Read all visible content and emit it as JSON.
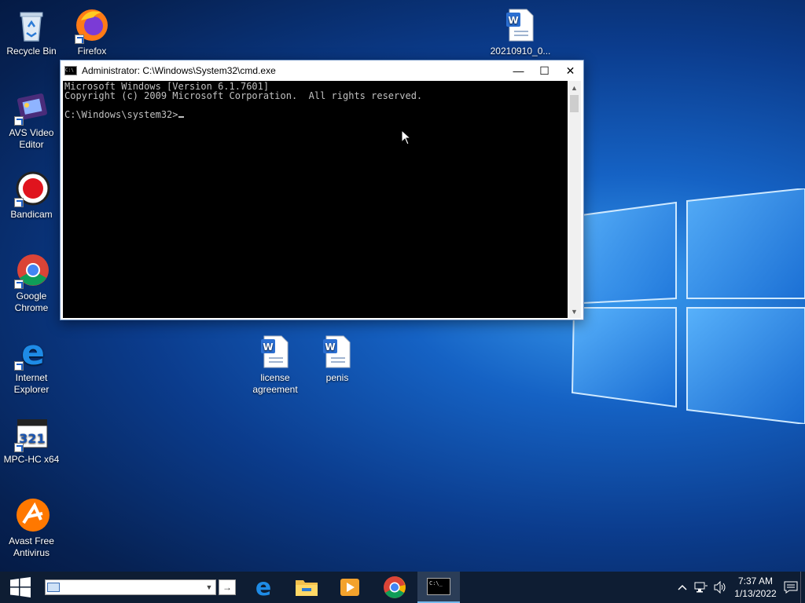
{
  "desktop": {
    "icons": [
      {
        "label": "Recycle Bin"
      },
      {
        "label": "Firefox"
      },
      {
        "label": "20210910_0..."
      },
      {
        "label": "AVS Video Editor"
      },
      {
        "label": "Bandicam"
      },
      {
        "label": "Google Chrome"
      },
      {
        "label": "Internet Explorer"
      },
      {
        "label": "MPC-HC x64"
      },
      {
        "label": "Avast Free Antivirus"
      },
      {
        "label": "license agreement"
      },
      {
        "label": "penis"
      }
    ]
  },
  "cmd_window": {
    "title": "Administrator: C:\\Windows\\System32\\cmd.exe",
    "icon_text": "C:\\",
    "lines": [
      "Microsoft Windows [Version 6.1.7601]",
      "Copyright (c) 2009 Microsoft Corporation.  All rights reserved.",
      "",
      "C:\\Windows\\system32>"
    ],
    "minimize": "—",
    "maximize": "☐",
    "close": "✕"
  },
  "taskbar": {
    "address_value": "",
    "go_label": "→",
    "apps": [
      "edge-icon",
      "file-explorer-icon",
      "media-player-icon",
      "chrome-icon",
      "cmd-icon"
    ],
    "cmd_icon_text": "C:\\_",
    "tray": {
      "time": "7:37 AM",
      "date": "1/13/2022",
      "chevron": "^"
    }
  },
  "colors": {
    "taskbar": "#0e1d33",
    "console_bg": "#000000",
    "console_text": "#c0c0c0",
    "accent": "#76b9ed"
  }
}
